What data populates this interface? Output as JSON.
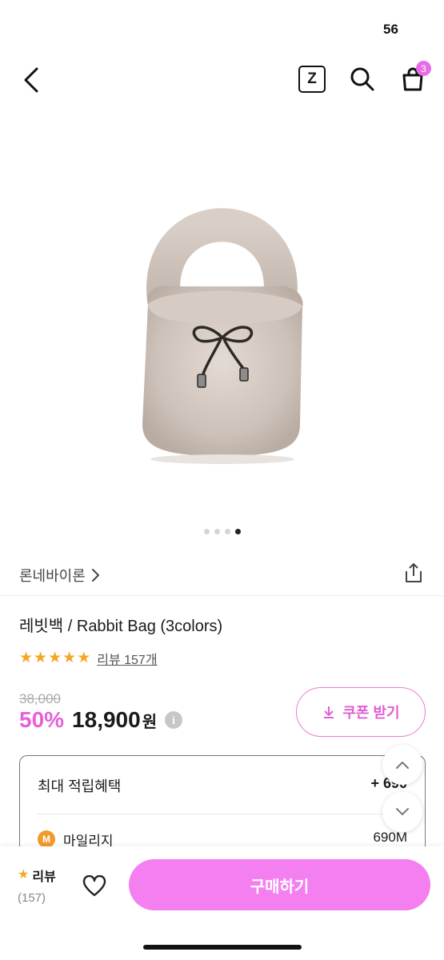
{
  "status_bar": {
    "battery": "56"
  },
  "nav": {
    "back_icon": "chevron-left-icon",
    "z_label": "Z",
    "search_icon": "search-icon",
    "cart_icon": "shopping-bag-icon",
    "cart_count": "3"
  },
  "gallery": {
    "total_images": 4,
    "active_index": 3
  },
  "brand": {
    "name": "론네바이론",
    "share_icon": "share-icon"
  },
  "product": {
    "title": "레빗백 / Rabbit Bag (3colors)",
    "rating_stars": 5,
    "review_link": "리뷰 157개",
    "original_price": "38,000",
    "discount": "50%",
    "price": "18,900",
    "currency": "원",
    "info_icon": "i"
  },
  "coupon": {
    "label": "쿠폰 받기",
    "icon": "download-icon"
  },
  "benefits": {
    "title": "최대 적립혜택",
    "value": "+ 690",
    "mileage_icon_letter": "M",
    "mileage_label": "마일리지",
    "mileage_value": "690M"
  },
  "bottom_bar": {
    "review_label": "리뷰",
    "review_count": "(157)",
    "buy_label": "구매하기"
  },
  "colors": {
    "accent_pink": "#f47ff0",
    "discount_pink": "#e760d9",
    "star": "#f5a623",
    "battery_yellow": "#f5d31b"
  }
}
